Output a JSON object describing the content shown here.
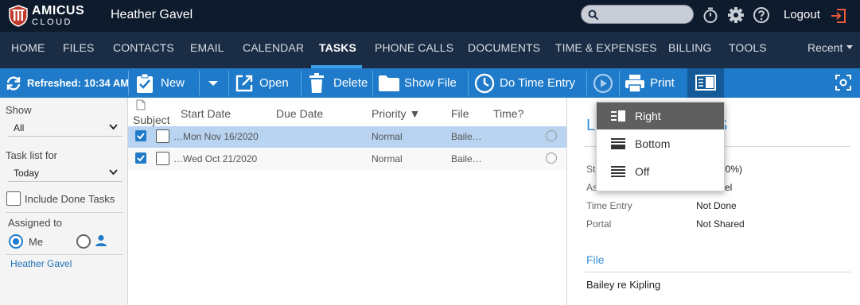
{
  "app": {
    "logo_line1": "AMICUS",
    "logo_line2": "CLOUD",
    "user_name": "Heather Gavel",
    "logout_label": "Logout"
  },
  "nav": {
    "items": [
      "HOME",
      "FILES",
      "CONTACTS",
      "EMAIL",
      "CALENDAR",
      "TASKS",
      "PHONE CALLS",
      "DOCUMENTS",
      "TIME & EXPENSES",
      "BILLING",
      "TOOLS"
    ],
    "active": "TASKS",
    "recent_label": "Recent"
  },
  "toolbar": {
    "refreshed": "Refreshed: 10:34 AM",
    "new": "New",
    "open": "Open",
    "delete": "Delete",
    "show_file": "Show File",
    "do_time_entry": "Do Time Entry",
    "print": "Print"
  },
  "filters": {
    "show_label": "Show",
    "show_value": "All",
    "task_list_label": "Task list for",
    "task_list_value": "Today",
    "include_done_label": "Include Done Tasks",
    "assigned_label": "Assigned to",
    "me_label": "Me",
    "assigned_user": "Heather Gavel"
  },
  "task_list": {
    "columns": {
      "subject": "Subject",
      "start_date": "Start Date",
      "due_date": "Due Date",
      "priority": "Priority ▼",
      "file": "File",
      "time": "Time?"
    },
    "rows": [
      {
        "start_date": "…Mon Nov 16/2020",
        "due_date": "",
        "priority": "Normal",
        "file": "Baile…",
        "selected": true
      },
      {
        "start_date": "…Wed Oct 21/2020",
        "due_date": "",
        "priority": "Normal",
        "file": "Baile…",
        "selected": false
      }
    ]
  },
  "detail": {
    "title_left": "L",
    "title_right": "S",
    "fields": [
      {
        "key": "Sta",
        "value": "gress (0%)"
      },
      {
        "key": "Assi",
        "value": "er Gavel"
      },
      {
        "key": "Time Entry",
        "value": "Not Done"
      },
      {
        "key": "Portal",
        "value": "Not Shared"
      }
    ],
    "file_section": "File",
    "file_value": "Bailey re Kipling"
  },
  "layout_menu": {
    "items": [
      {
        "label": "Right",
        "icon": "layout-right-icon",
        "active": true
      },
      {
        "label": "Bottom",
        "icon": "layout-bottom-icon",
        "active": false
      },
      {
        "label": "Off",
        "icon": "layout-off-icon",
        "active": false
      }
    ]
  },
  "colors": {
    "topbar": "#0d1b2d",
    "navbar": "#1b2d44",
    "toolbar": "#1f7bc9",
    "accent": "#3a8fd6",
    "selected_row": "#b8d4f0",
    "logout_icon": "#e8583a"
  }
}
